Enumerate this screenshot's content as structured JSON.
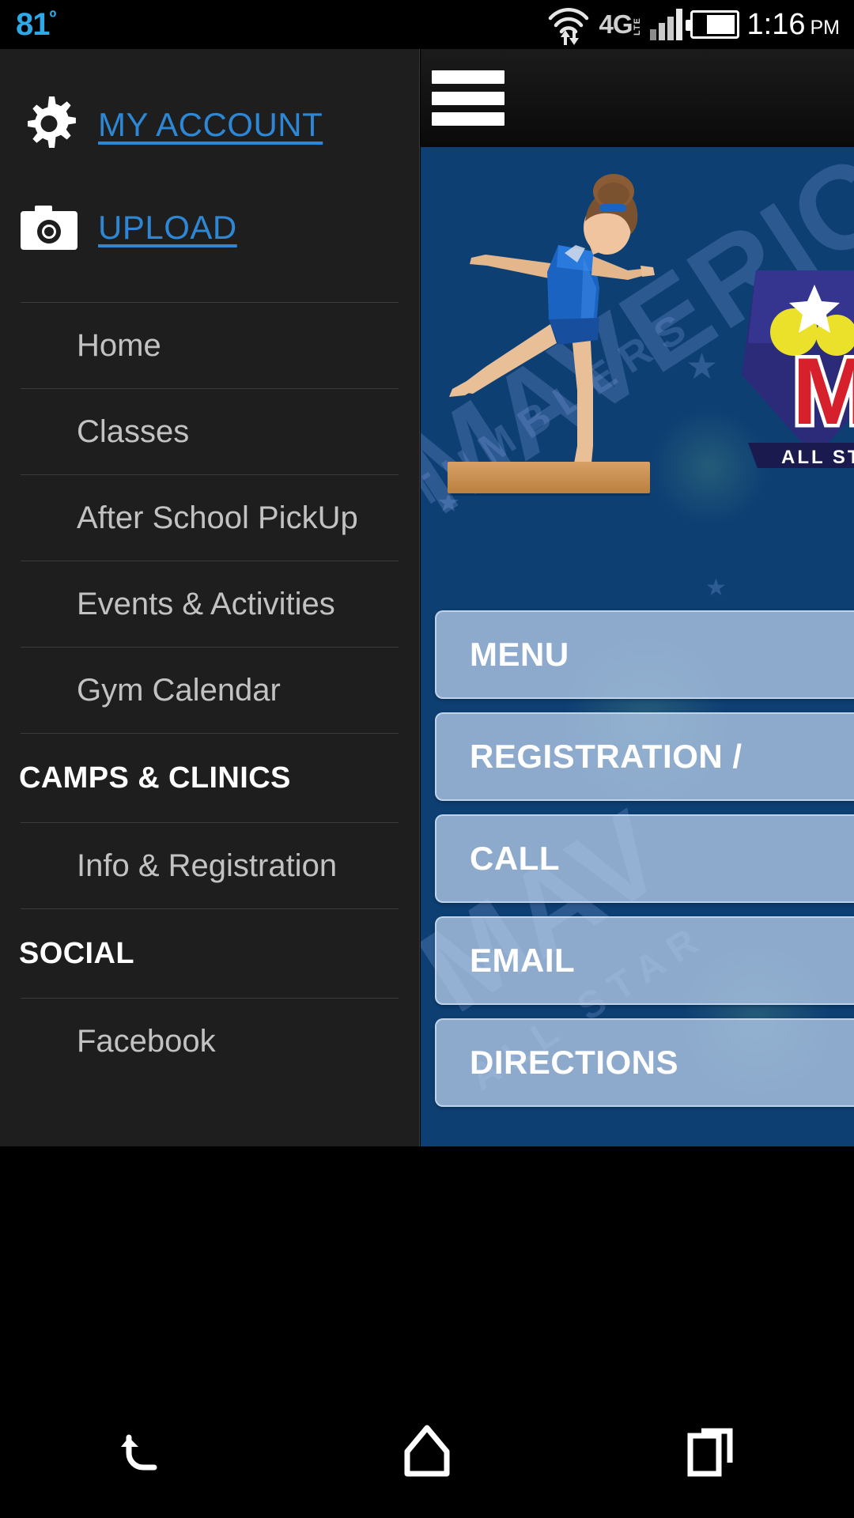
{
  "status_bar": {
    "temperature": "81",
    "degree_symbol": "º",
    "network_type": "4G",
    "network_sub": "LTE",
    "time": "1:16",
    "meridiem": "PM",
    "icons": [
      "wifi-icon",
      "signal-bars-icon",
      "battery-icon"
    ],
    "temp_color": "#2fa8e8"
  },
  "drawer": {
    "account_link": {
      "label": "MY ACCOUNT",
      "icon": "gear-icon"
    },
    "upload_link": {
      "label": "UPLOAD",
      "icon": "camera-icon"
    },
    "link_color": "#2e87d4",
    "items": [
      {
        "label": "Home",
        "type": "item"
      },
      {
        "label": "Classes",
        "type": "item"
      },
      {
        "label": "After School PickUp",
        "type": "item"
      },
      {
        "label": "Events & Activities",
        "type": "item"
      },
      {
        "label": "Gym Calendar",
        "type": "item"
      }
    ],
    "sections": [
      {
        "header": "CAMPS & CLINICS",
        "items": [
          {
            "label": "Info & Registration"
          }
        ]
      },
      {
        "header": "SOCIAL",
        "items": [
          {
            "label": "Facebook"
          }
        ]
      }
    ]
  },
  "content": {
    "header": {
      "menu_icon": "hamburger-icon"
    },
    "hero": {
      "watermark_primary": "MAVERICK",
      "watermark_secondary": "TUMBLERS",
      "watermark_tertiary": "MAV",
      "watermark_allstar": "ALL STAR",
      "logo_letter": "M",
      "logo_allstar": "ALL STAR",
      "background_color": "#10457a"
    },
    "buttons": [
      {
        "label": "MENU"
      },
      {
        "label": "REGISTRATION /"
      },
      {
        "label": "CALL"
      },
      {
        "label": "EMAIL"
      },
      {
        "label": "DIRECTIONS"
      }
    ],
    "button_color": "#aec6e4"
  },
  "nav_bar": {
    "back": "back-icon",
    "home": "home-icon",
    "recents": "recents-icon"
  }
}
